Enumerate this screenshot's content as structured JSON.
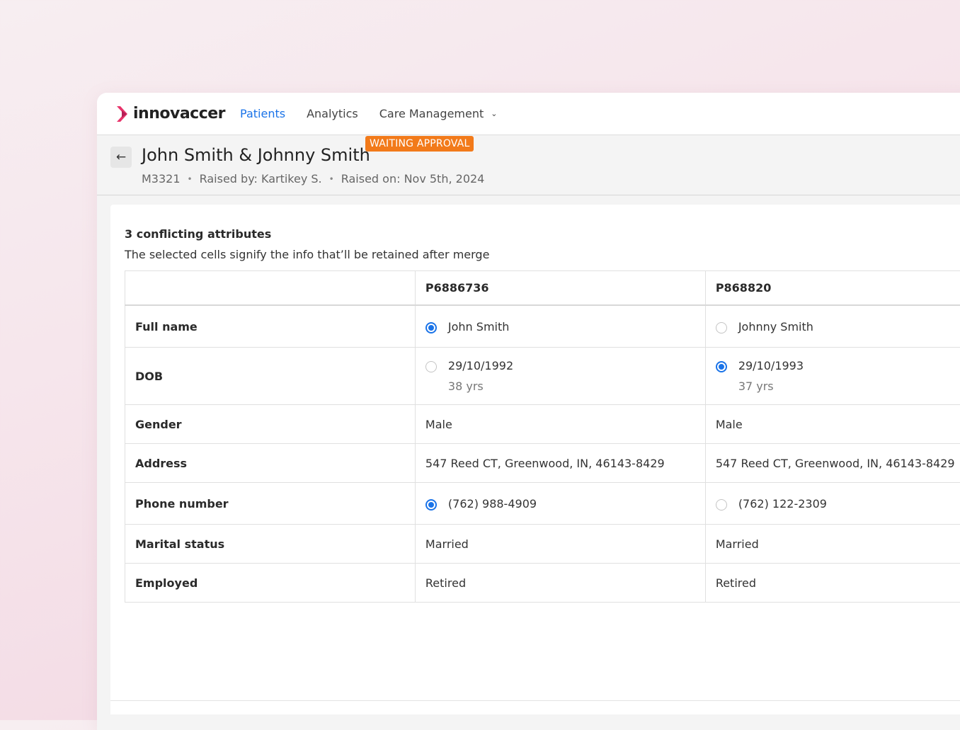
{
  "nav": {
    "logo_text": "innovaccer",
    "items": [
      {
        "label": "Patients",
        "active": true
      },
      {
        "label": "Analytics",
        "active": false
      },
      {
        "label": "Care Management",
        "active": false,
        "has_dropdown": true
      }
    ]
  },
  "header": {
    "title": "John Smith & Johnny Smith",
    "status": "WAITING APPROVAL",
    "meta": {
      "id": "M3321",
      "raised_by": "Raised by: Kartikey S.",
      "raised_on": "Raised on: Nov 5th, 2024"
    }
  },
  "conflicts": {
    "title": "3 conflicting attributes",
    "subtitle": "The selected cells signify the info that’ll be retained after merge"
  },
  "table": {
    "columns": [
      "",
      "P6886736",
      "P868820"
    ],
    "rows": [
      {
        "label": "Full name",
        "a": "John Smith",
        "b": "Johnny Smith",
        "selectable": true,
        "selected": "a"
      },
      {
        "label": "DOB",
        "a": "29/10/1992",
        "a_sub": "38 yrs",
        "b": "29/10/1993",
        "b_sub": "37 yrs",
        "selectable": true,
        "selected": "b"
      },
      {
        "label": "Gender",
        "a": "Male",
        "b": "Male",
        "selectable": false
      },
      {
        "label": "Address",
        "a": "547 Reed CT, Greenwood, IN, 46143-8429",
        "b": "547 Reed CT, Greenwood, IN, 46143-8429",
        "selectable": false
      },
      {
        "label": "Phone number",
        "a": "(762) 988-4909",
        "b": "(762) 122-2309",
        "selectable": true,
        "selected": "a"
      },
      {
        "label": "Marital status",
        "a": "Married",
        "b": "Married",
        "selectable": false
      },
      {
        "label": "Employed",
        "a": "Retired",
        "b": "Retired",
        "selectable": false
      }
    ]
  },
  "colors": {
    "accent": "#1a73e8",
    "badge": "#f27a1a",
    "logo_pink": "#e8346b"
  }
}
